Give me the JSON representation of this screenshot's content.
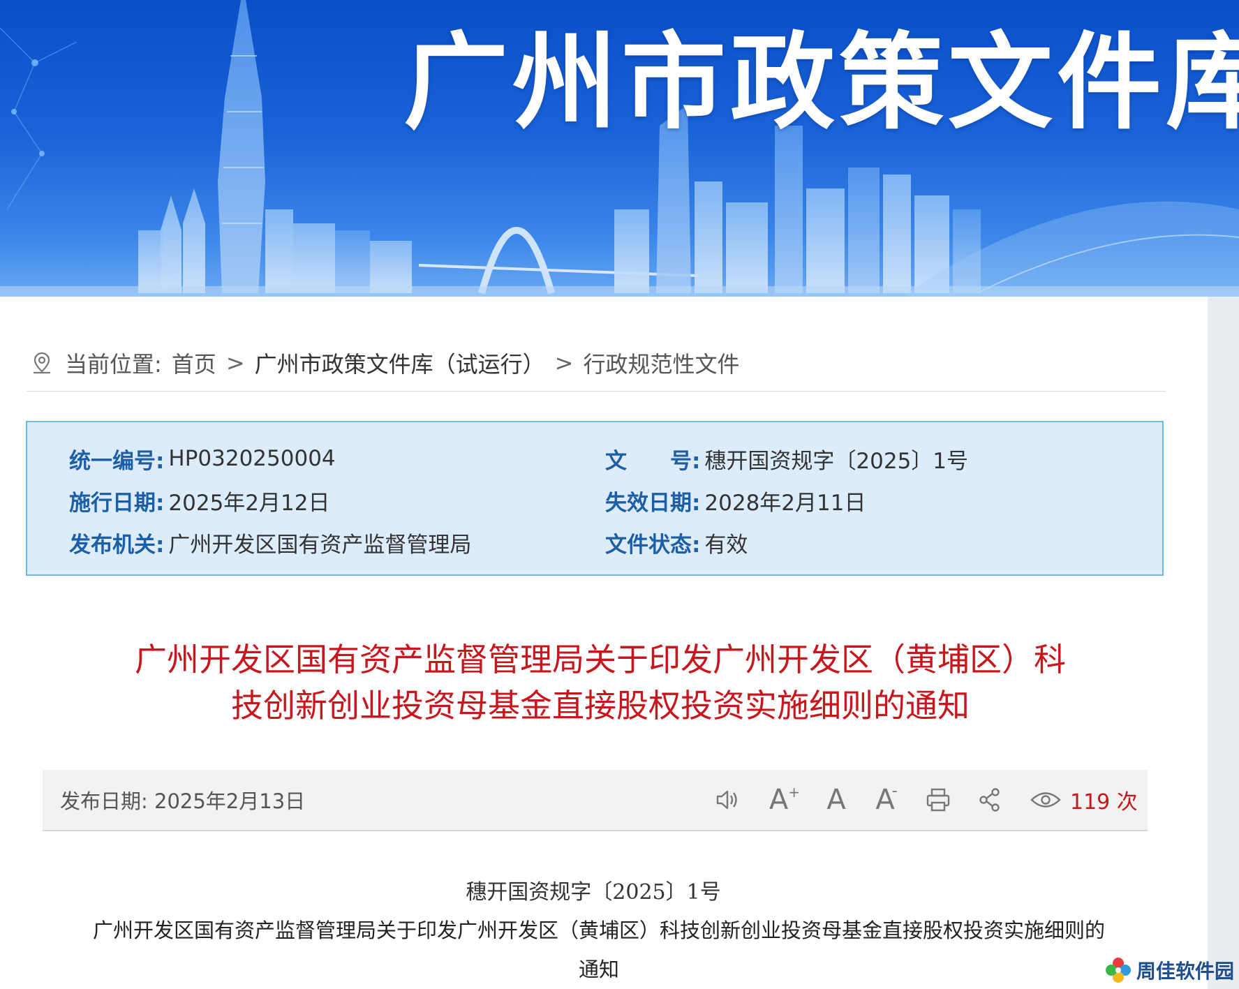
{
  "banner": {
    "title": "广州市政策文件库"
  },
  "breadcrumb": {
    "prefix": "当前位置:",
    "items": [
      "首页",
      "广州市政策文件库（试运行）",
      "行政规范性文件"
    ],
    "separator": ">"
  },
  "info": {
    "unified_no_label": "统一编号:",
    "unified_no": "HP0320250004",
    "doc_no_label": "文　　号:",
    "doc_no": "穗开国资规字〔2025〕1号",
    "effective_date_label": "施行日期:",
    "effective_date": "2025年2月12日",
    "expiry_date_label": "失效日期:",
    "expiry_date": "2028年2月11日",
    "issuer_label": "发布机关:",
    "issuer": "广州开发区国有资产监督管理局",
    "status_label": "文件状态:",
    "status": "有效"
  },
  "document": {
    "title_line1": "广州开发区国有资产监督管理局关于印发广州开发区（黄埔区）科",
    "title_line2": "技创新创业投资母基金直接股权投资实施细则的通知",
    "doc_number": "穗开国资规字〔2025〕1号",
    "head_line1": "广州开发区国有资产监督管理局关于印发广州开发区（黄埔区）科技创新创业投资母基金直接股权投资实施细则的",
    "head_line2": "通知"
  },
  "toolbar": {
    "publish_date": "发布日期: 2025年2月13日",
    "font_increase_glyph": "A",
    "font_default_glyph": "A",
    "font_decrease_glyph": "A",
    "views": "119 次"
  },
  "watermark": {
    "text": "周佳软件园"
  },
  "colors": {
    "banner_blue": "#1a63d8",
    "label_blue": "#1c5fa8",
    "title_red": "#c8161d",
    "info_bg": "#dcecfb",
    "info_border": "#6fb8e6"
  }
}
